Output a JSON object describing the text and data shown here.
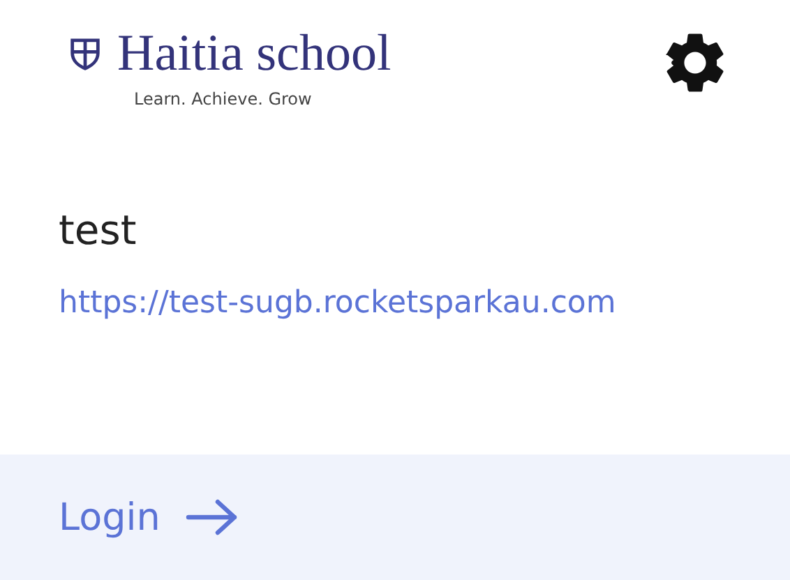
{
  "header": {
    "school_name": "Haitia school",
    "tagline": "Learn. Achieve. Grow"
  },
  "site": {
    "name": "test",
    "url": "https://test-sugb.rocketsparkau.com"
  },
  "footer": {
    "login_label": "Login"
  }
}
